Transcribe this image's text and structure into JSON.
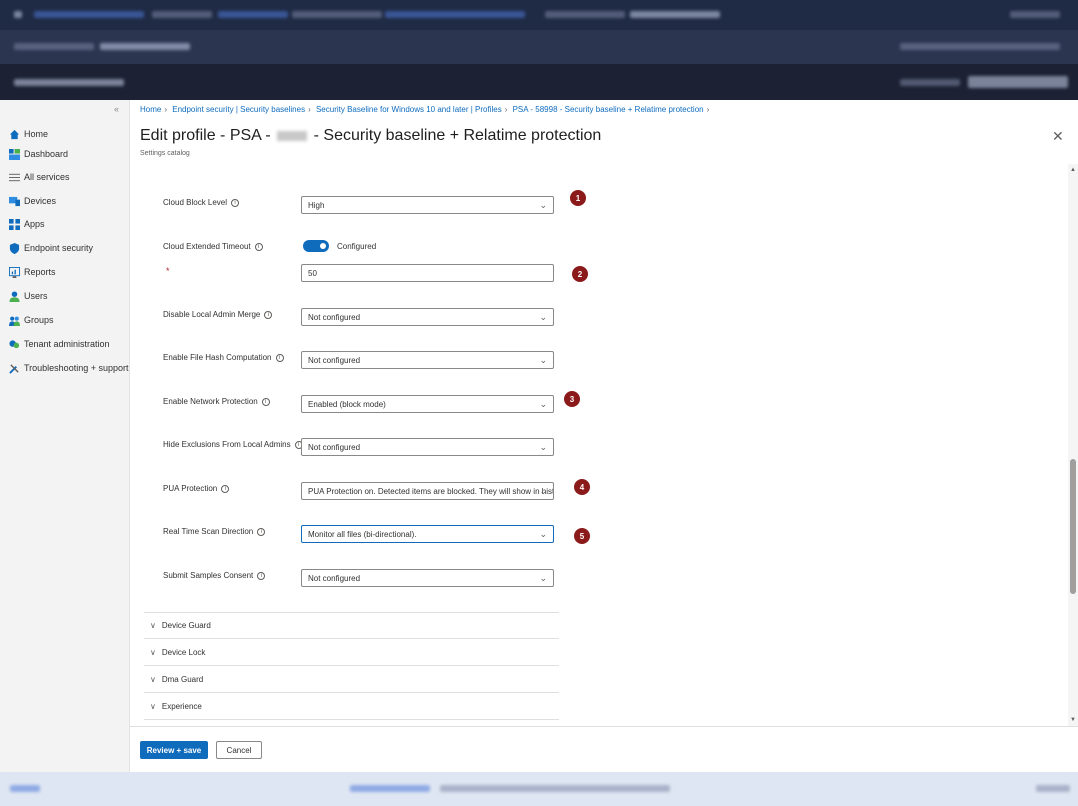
{
  "nav": {
    "items": [
      {
        "label": "Home",
        "icon": "home-icon"
      },
      {
        "label": "Dashboard",
        "icon": "dashboard-icon"
      },
      {
        "label": "All services",
        "icon": "list-icon"
      },
      {
        "label": "Devices",
        "icon": "devices-icon"
      },
      {
        "label": "Apps",
        "icon": "apps-icon"
      },
      {
        "label": "Endpoint security",
        "icon": "shield-icon"
      },
      {
        "label": "Reports",
        "icon": "reports-icon"
      },
      {
        "label": "Users",
        "icon": "user-icon"
      },
      {
        "label": "Groups",
        "icon": "groups-icon"
      },
      {
        "label": "Tenant administration",
        "icon": "tenant-icon"
      },
      {
        "label": "Troubleshooting + support",
        "icon": "tools-icon"
      }
    ]
  },
  "breadcrumb": {
    "items": [
      "Home",
      "Endpoint security | Security baselines",
      "Security Baseline for Windows 10 and later | Profiles",
      "PSA - 58998 - Security baseline + Relatime protection"
    ]
  },
  "header": {
    "title_prefix": "Edit profile - PSA -",
    "title_suffix": "- Security baseline + Relatime protection",
    "subtitle": "Settings catalog",
    "more": "···",
    "close": "✕"
  },
  "settings": {
    "cloud_block_level": {
      "label": "Cloud Block Level",
      "value": "High",
      "badge": "1"
    },
    "cloud_extended_timeout": {
      "label": "Cloud Extended Timeout",
      "toggle": "Configured"
    },
    "timeout_value": {
      "required": "*",
      "value": "50",
      "badge": "2"
    },
    "disable_local_admin_merge": {
      "label": "Disable Local Admin Merge",
      "value": "Not configured"
    },
    "enable_file_hash": {
      "label": "Enable File Hash Computation",
      "value": "Not configured"
    },
    "enable_network_protection": {
      "label": "Enable Network Protection",
      "value": "Enabled (block mode)",
      "badge": "3"
    },
    "hide_exclusions": {
      "label": "Hide Exclusions From Local Admins",
      "value": "Not configured"
    },
    "pua_protection": {
      "label": "PUA Protection",
      "value": "PUA Protection on. Detected items are blocked. They will show in hist...",
      "badge": "4"
    },
    "real_time_scan": {
      "label": "Real Time Scan Direction",
      "value": "Monitor all files (bi-directional).",
      "badge": "5"
    },
    "submit_samples": {
      "label": "Submit Samples Consent",
      "value": "Not configured"
    }
  },
  "sections": [
    "Device Guard",
    "Device Lock",
    "Dma Guard",
    "Experience"
  ],
  "footer": {
    "save": "Review + save",
    "cancel": "Cancel"
  },
  "colors": {
    "accent": "#0f6cbd",
    "badge": "#8b1a1a"
  }
}
